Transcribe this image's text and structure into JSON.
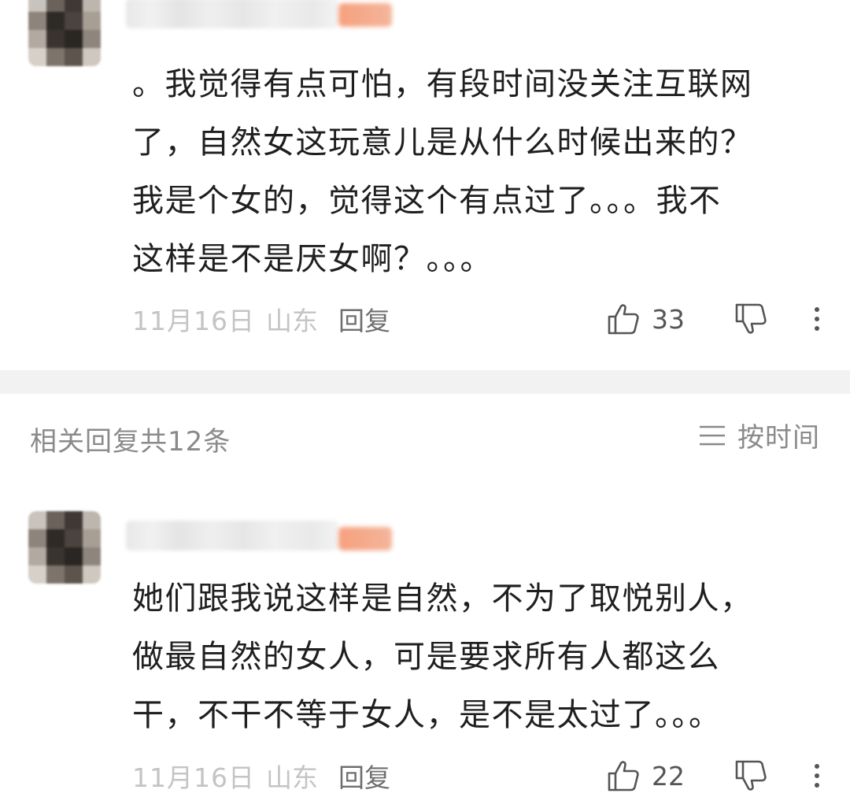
{
  "main_comment": {
    "avatar_icon": "user-avatar-blurred",
    "body_lines": [
      "。我觉得有点可怕，有段时间没关注互联网",
      "了，自然女这玩意儿是从什么时候出来的？",
      "我是个女的，觉得这个有点过了。。。我不",
      "这样是不是厌女啊？。。。"
    ],
    "date": "11月16日",
    "location": "山东",
    "reply_label": "回复",
    "like_icon": "thumbs-up-icon",
    "like_count": "33",
    "dislike_icon": "thumbs-down-icon",
    "more_icon": "more-vertical-icon"
  },
  "related": {
    "title": "相关回复共12条",
    "sort_icon": "list-sort-icon",
    "sort_label": "按时间"
  },
  "reply_comment": {
    "avatar_icon": "user-avatar-blurred",
    "body_lines": [
      "她们跟我说这样是自然，不为了取悦别人，",
      "做最自然的女人，可是要求所有人都这么",
      "干，不干不等于女人，是不是太过了。。。"
    ],
    "date": "11月16日",
    "location": "山东",
    "reply_label": "回复",
    "like_icon": "thumbs-up-icon",
    "like_count": "22",
    "dislike_icon": "thumbs-down-icon",
    "more_icon": "more-vertical-icon"
  },
  "colors": {
    "text_primary": "#1f1f1f",
    "text_meta": "#c4c4c4",
    "text_secondary": "#8a8a8a",
    "icon": "#555555",
    "divider": "#f2f2f2",
    "badge": "#f6a07e"
  }
}
